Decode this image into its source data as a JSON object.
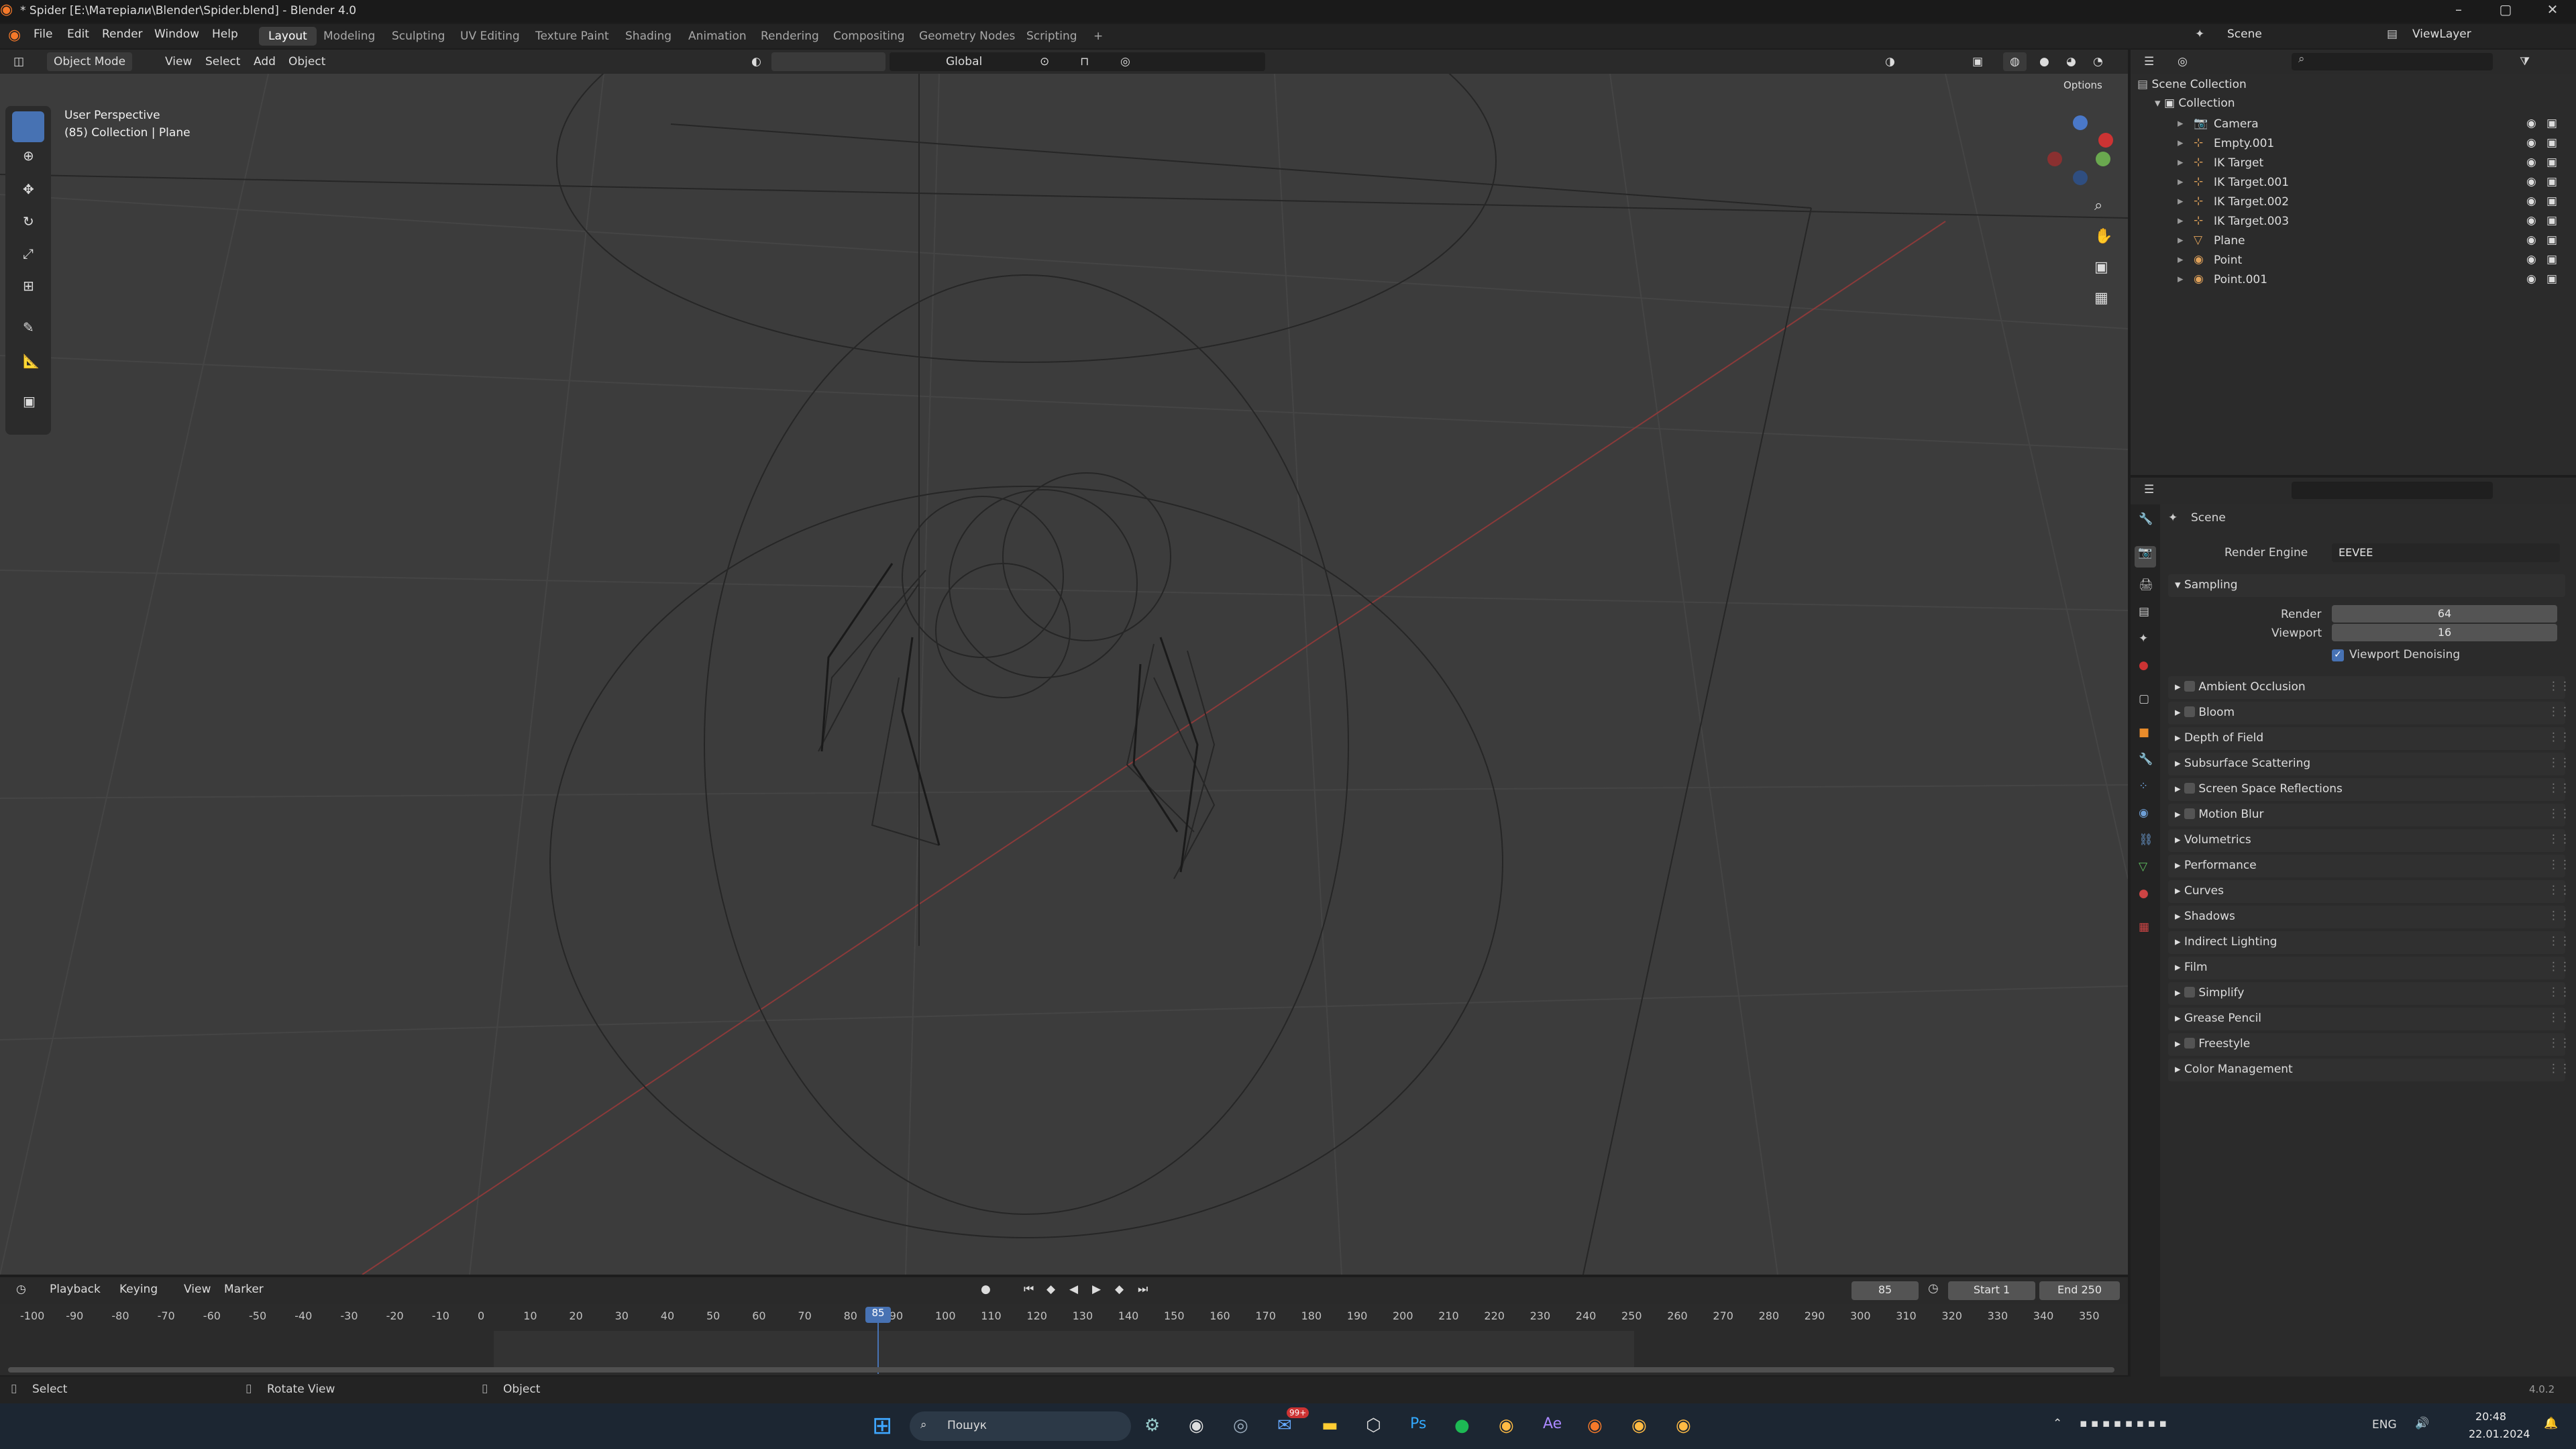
{
  "window": {
    "title": "* Spider [E:\\Матеріали\\Blender\\Spider.blend] - Blender 4.0",
    "min": "–",
    "max": "▢",
    "close": "✕"
  },
  "menubar": {
    "items": [
      "File",
      "Edit",
      "Render",
      "Window",
      "Help"
    ]
  },
  "workspaces": {
    "tabs": [
      "Layout",
      "Modeling",
      "Sculpting",
      "UV Editing",
      "Texture Paint",
      "Shading",
      "Animation",
      "Rendering",
      "Compositing",
      "Geometry Nodes",
      "Scripting"
    ],
    "active": "Layout",
    "add": "+"
  },
  "scene_selector": {
    "label": "Scene",
    "viewlayer": "ViewLayer"
  },
  "viewport_header": {
    "mode": "Object Mode",
    "menus": [
      "View",
      "Select",
      "Add",
      "Object"
    ],
    "orientation": "Global",
    "options": "Options"
  },
  "viewport": {
    "view_name": "User Perspective",
    "info": "(85) Collection | Plane"
  },
  "outliner": {
    "root": "Scene Collection",
    "collection": "Collection",
    "items": [
      "Camera",
      "Empty.001",
      "IK Target",
      "IK Target.001",
      "IK Target.002",
      "IK Target.003",
      "Plane",
      "Point",
      "Point.001"
    ]
  },
  "properties": {
    "scene_label": "Scene",
    "render_engine_label": "Render Engine",
    "render_engine": "EEVEE",
    "sampling": {
      "title": "Sampling",
      "render_label": "Render",
      "render_value": "64",
      "viewport_label": "Viewport",
      "viewport_value": "16",
      "denoise_label": "Viewport Denoising"
    },
    "panels": [
      "Ambient Occlusion",
      "Bloom",
      "Depth of Field",
      "Subsurface Scattering",
      "Screen Space Reflections",
      "Motion Blur",
      "Volumetrics",
      "Performance",
      "Curves",
      "Shadows",
      "Indirect Lighting",
      "Film",
      "Simplify",
      "Grease Pencil",
      "Freestyle",
      "Color Management"
    ]
  },
  "timeline": {
    "menus": [
      "Playback",
      "Keying",
      "View",
      "Marker"
    ],
    "current_frame": "85",
    "start_label": "Start",
    "start": "1",
    "end_label": "End",
    "end": "250",
    "ticks": [
      "-100",
      "-90",
      "-80",
      "-70",
      "-60",
      "-50",
      "-40",
      "-30",
      "-20",
      "-10",
      "0",
      "10",
      "20",
      "30",
      "40",
      "50",
      "60",
      "70",
      "80",
      "90",
      "100",
      "110",
      "120",
      "130",
      "140",
      "150",
      "160",
      "170",
      "180",
      "190",
      "200",
      "210",
      "220",
      "230",
      "240",
      "250",
      "260",
      "270",
      "280",
      "290",
      "300",
      "310",
      "320",
      "330",
      "340",
      "350"
    ]
  },
  "statusbar": {
    "select": "Select",
    "rotate": "Rotate View",
    "object": "Object",
    "version": "4.0.2"
  },
  "taskbar": {
    "search": "Пошук",
    "lang": "ENG",
    "time": "20:48",
    "date": "22.01.2024",
    "badge": "99+"
  },
  "colors": {
    "accent": "#4772b3",
    "active_frame": "#4772b3",
    "x_axis": "#cc3333",
    "y_axis": "#6aa84f",
    "z_axis": "#4a78c8"
  }
}
